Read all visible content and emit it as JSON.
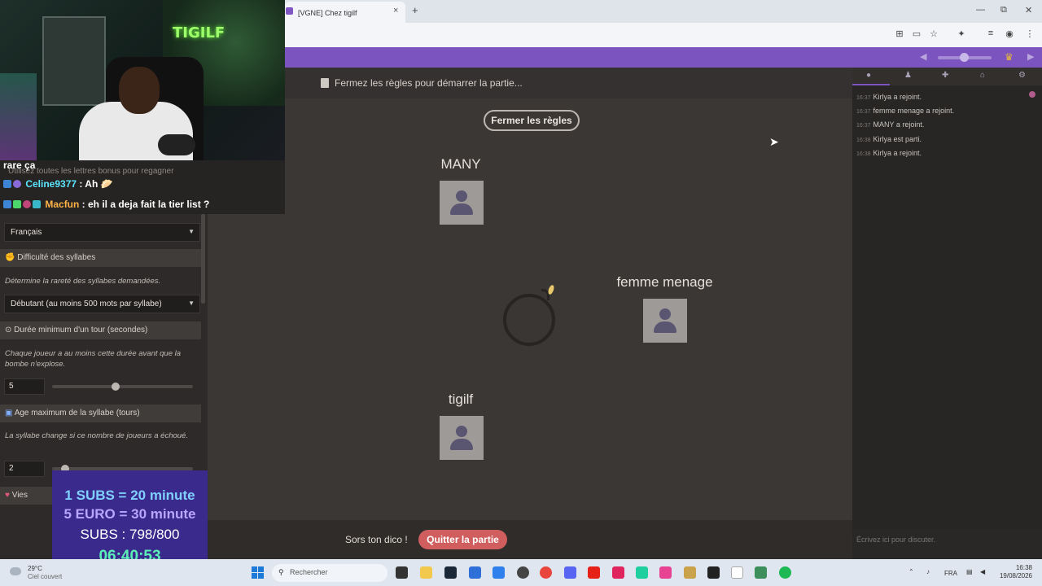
{
  "browser": {
    "tab_title": "[VGNE] Chez tigilf",
    "tab_close": "×",
    "new_tab": "+",
    "win_minimize": "—",
    "win_restore": "⧉",
    "win_close": "✕"
  },
  "game": {
    "rules_notice": "Fermez les règles pour démarrer la partie...",
    "close_rules_button": "Fermer les règles",
    "players": [
      {
        "name": "MANY"
      },
      {
        "name": "femme menage"
      },
      {
        "name": "tigilf"
      }
    ],
    "bottom_hint": "Sors ton dico !",
    "quit_button": "Quitter la partie"
  },
  "chat_panel": {
    "messages": [
      {
        "time": "16:37",
        "text": "Kirlya a rejoint."
      },
      {
        "time": "16:37",
        "text": "femme menage a rejoint."
      },
      {
        "time": "16:37",
        "text": "MANY a rejoint."
      },
      {
        "time": "16:38",
        "text": "Kirlya est parti."
      },
      {
        "time": "16:38",
        "text": "Kirlya a rejoint."
      }
    ],
    "input_placeholder": "Écrivez ici pour discuter."
  },
  "settings": {
    "faded_text": "Utilisez toutes les lettres bonus pour regagner",
    "language_value": "Français",
    "syllable_difficulty": {
      "heading": "Difficulté des syllabes",
      "description": "Détermine la rareté des syllabes demandées.",
      "value": "Débutant (au moins 500 mots par syllabe)"
    },
    "min_turn_duration": {
      "heading": "Durée minimum d'un tour (secondes)",
      "description": "Chaque joueur a au moins cette durée avant que la bombe n'explose.",
      "value": "5"
    },
    "max_syllable_age": {
      "heading": "Age maximum de la syllabe (tours)",
      "description": "La syllabe change si ce nombre de joueurs a échoué.",
      "value": "2"
    },
    "lives": {
      "heading": "Vies"
    }
  },
  "twitch_chat": {
    "lines": [
      {
        "user": "",
        "message": "rare ça"
      },
      {
        "user": "Celine9377",
        "message": " : Ah",
        "color": "#5be6ff"
      },
      {
        "user": "Macfun",
        "message": " : eh il a deja fait la tier list ?",
        "color": "#ffb347"
      }
    ]
  },
  "webcam": {
    "neon_sign": "TIGILF"
  },
  "subs_overlay": {
    "line1": "1 SUBS = 20 minute",
    "line2": "5 EURO = 30 minute",
    "line3": "SUBS : 798/800",
    "timer": "06:40:53",
    "colors": {
      "line1": "#7fd0ff",
      "line2": "#b9a6ff",
      "line3": "#ffffff",
      "timer": "#5cf0b8"
    }
  },
  "taskbar": {
    "weather_temp": "29°C",
    "weather_desc": "Ciel couvert",
    "search_placeholder": "Rechercher",
    "language": "FRA",
    "time": "16:38",
    "date": "19/08/2026"
  },
  "colors": {
    "accent": "#7c54bf",
    "quit": "#d05e5e",
    "page_bg": "#3b3735"
  }
}
